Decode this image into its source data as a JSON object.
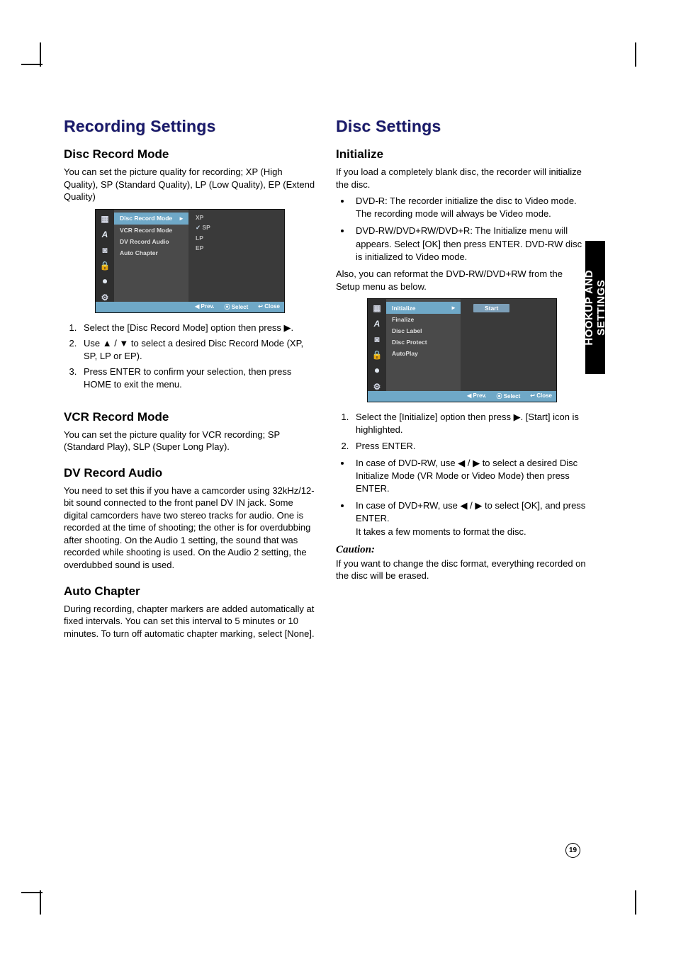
{
  "pageNumber": "19",
  "sideTab": {
    "line1": "HOOKUP AND",
    "line2": "SETTINGS"
  },
  "left": {
    "title": "Recording Settings",
    "s1": {
      "heading": "Disc Record Mode",
      "p1": "You can set the picture quality for recording; XP (High Quality), SP (Standard Quality), LP (Low Quality), EP (Extend Quality)",
      "step1": "Select the [Disc Record Mode] option then press ▶.",
      "step2": "Use ▲ / ▼ to select a desired Disc Record Mode (XP, SP, LP or EP).",
      "step3": "Press ENTER to confirm your selection, then press HOME to exit the menu."
    },
    "s2": {
      "heading": "VCR Record Mode",
      "p1": "You can set the picture quality for VCR recording; SP (Standard Play), SLP (Super Long Play)."
    },
    "s3": {
      "heading": "DV Record Audio",
      "p1": "You need to set this if you have a camcorder using 32kHz/12-bit sound connected to the front panel DV IN jack. Some digital camcorders have two stereo tracks for audio. One is recorded at the time of shooting; the other is for overdubbing after shooting. On the Audio 1 setting, the sound that was recorded while shooting is used. On the Audio 2 setting, the overdubbed sound is used."
    },
    "s4": {
      "heading": "Auto Chapter",
      "p1": "During recording, chapter markers are added automatically at fixed intervals. You can set this interval to 5 minutes or 10 minutes. To turn off automatic chapter marking, select [None]."
    },
    "osd": {
      "menu": [
        "Disc Record Mode",
        "VCR Record Mode",
        "DV Record Audio",
        "Auto Chapter"
      ],
      "options": [
        "XP",
        "SP",
        "LP",
        "EP"
      ],
      "selectedOption": "SP",
      "footerPrev": "◀ Prev.",
      "footerSelect": "⦿ Select",
      "footerClose": "↩ Close"
    }
  },
  "right": {
    "title": "Disc Settings",
    "s1": {
      "heading": "Initialize",
      "p1": "If you load a completely blank disc, the recorder will initialize the disc.",
      "b1": "DVD-R: The recorder initialize the disc to Video mode. The recording mode will always be Video mode.",
      "b2": "DVD-RW/DVD+RW/DVD+R: The Initialize menu will appears. Select [OK] then press ENTER. DVD-RW disc is initialized to Video mode.",
      "p2": "Also, you can reformat the DVD-RW/DVD+RW from the Setup menu as below.",
      "step1": "Select the [Initialize] option then press ▶. [Start] icon is highlighted.",
      "step2": "Press ENTER.",
      "b3": "In case of DVD-RW, use ◀ / ▶ to select a desired Disc Initialize Mode (VR Mode or Video Mode) then press ENTER.",
      "b4": "In case of DVD+RW, use ◀ / ▶ to select [OK], and press ENTER.",
      "b4b": "It takes a few moments to format the disc."
    },
    "caution": {
      "heading": "Caution:",
      "p1": "If you want to change the disc format, everything recorded on the disc will be erased."
    },
    "osd": {
      "menu": [
        "Initialize",
        "Finalize",
        "Disc Label",
        "Disc Protect",
        "AutoPlay"
      ],
      "start": "Start",
      "footerPrev": "◀ Prev.",
      "footerSelect": "⦿ Select",
      "footerClose": "↩ Close"
    }
  },
  "chart_data": null
}
